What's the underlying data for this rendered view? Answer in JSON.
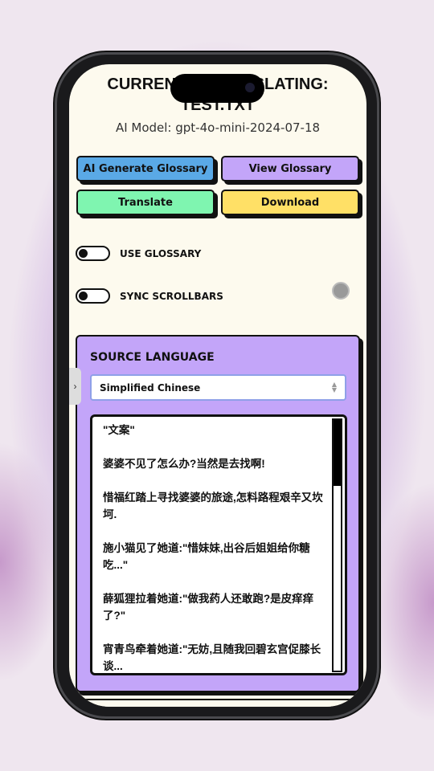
{
  "header": {
    "title": "CURRENTLY TRANSLATING: TEST.TXT",
    "model": "AI Model: gpt-4o-mini-2024-07-18"
  },
  "buttons": {
    "generate": "AI Generate Glossary",
    "view": "View Glossary",
    "translate": "Translate",
    "download": "Download"
  },
  "toggles": {
    "glossary": "USE GLOSSARY",
    "sync": "SYNC SCROLLBARS"
  },
  "source": {
    "label": "SOURCE LANGUAGE",
    "selected": "Simplified Chinese",
    "paragraphs": [
      "\"文案\"",
      "婆婆不见了怎么办?当然是去找啊!",
      "惜福红踏上寻找婆婆的旅途,怎料路程艰辛又坎坷.",
      "施小猫见了她道:\"惜妹妹,出谷后姐姐给你糖吃...\"",
      "薛狐狸拉着她道:\"做我药人还敢跑?是皮痒痒了?\"",
      "宵青鸟牵着她道:\"无妨,且随我回碧玄宫促膝长谈..."
    ]
  },
  "colors": {
    "generate": "#5aa9e6",
    "view": "#c3a5f9",
    "translate": "#7ff5b0",
    "download": "#ffe066",
    "screen": "#fdfaee"
  }
}
